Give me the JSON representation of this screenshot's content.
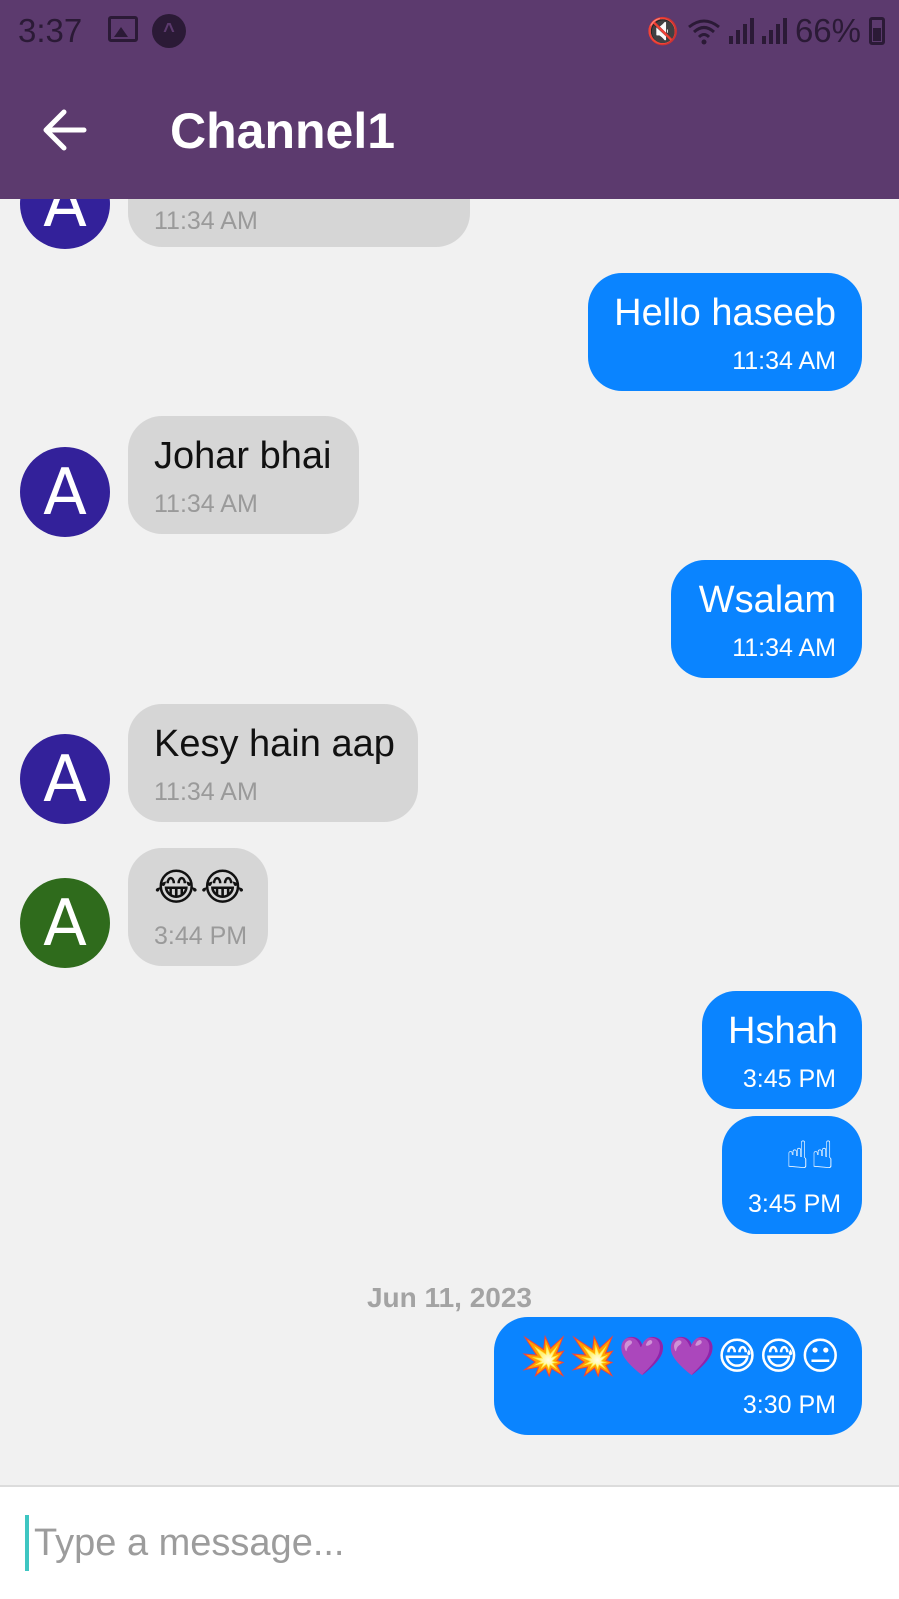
{
  "status_bar": {
    "time": "3:37",
    "battery": "66%",
    "icons": [
      "gallery-icon",
      "app-icon",
      "mute-icon",
      "wifi-icon",
      "signal-icon",
      "signal-icon",
      "battery-icon"
    ]
  },
  "header": {
    "back_icon": "arrow-left-icon",
    "title": "Channel1",
    "background": "#5c3a6e"
  },
  "colors": {
    "outgoing_bubble": "#0a84ff",
    "incoming_bubble": "#d6d6d6",
    "avatar_purple": "#33219a",
    "avatar_green": "#2f6b1c",
    "background": "#f1f1f1"
  },
  "messages": [
    {
      "direction": "incoming",
      "avatar": "A",
      "text": "",
      "time": "11:34 AM"
    },
    {
      "direction": "outgoing",
      "text": "Hello haseeb",
      "time": "11:34 AM"
    },
    {
      "direction": "incoming",
      "avatar": "A",
      "text": "Johar bhai",
      "time": "11:34 AM"
    },
    {
      "direction": "outgoing",
      "text": "Wsalam",
      "time": "11:34 AM"
    },
    {
      "direction": "incoming",
      "avatar": "A",
      "text": "Kesy hain aap",
      "time": "11:34 AM"
    },
    {
      "direction": "incoming",
      "avatar": "A",
      "text": "😂😂",
      "time": "3:44 PM"
    },
    {
      "direction": "outgoing",
      "text": "Hshah",
      "time": "3:45 PM"
    },
    {
      "direction": "outgoing",
      "text": "☝☝",
      "time": "3:45 PM"
    },
    {
      "direction": "outgoing",
      "text": "💥💥💜💜😅😅😐",
      "time": "3:30 PM"
    }
  ],
  "date_separator": "Jun 11, 2023",
  "composer": {
    "placeholder": "Type a message...",
    "value": ""
  }
}
